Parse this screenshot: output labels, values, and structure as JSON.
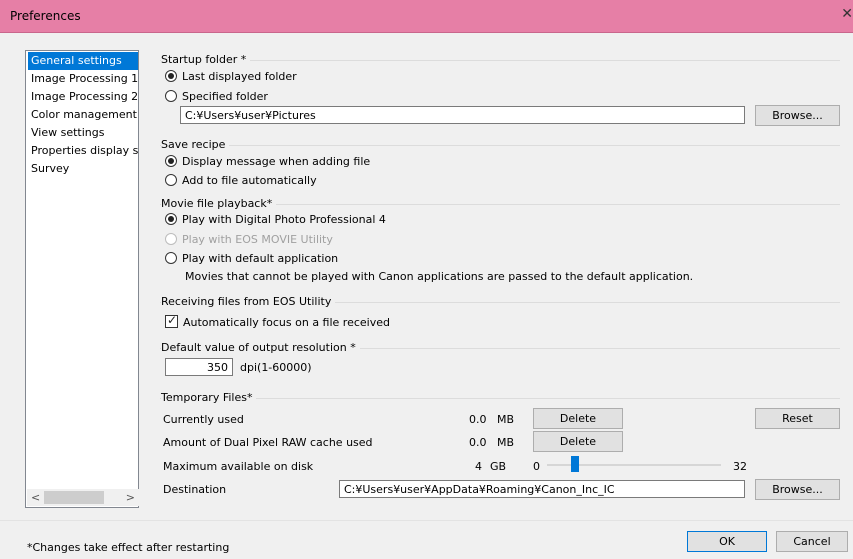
{
  "window": {
    "title": "Preferences",
    "close_glyph": "✕"
  },
  "sidebar": {
    "items": [
      {
        "label": "General settings",
        "selected": true
      },
      {
        "label": "Image Processing 1",
        "selected": false
      },
      {
        "label": "Image Processing 2",
        "selected": false
      },
      {
        "label": "Color management",
        "selected": false
      },
      {
        "label": "View settings",
        "selected": false
      },
      {
        "label": "Properties display sett",
        "selected": false
      },
      {
        "label": "Survey",
        "selected": false
      }
    ],
    "scroll_left": "<",
    "scroll_right": ">"
  },
  "startup_folder": {
    "label": "Startup folder *",
    "option_last": "Last displayed folder",
    "option_specified": "Specified folder",
    "selected": "last",
    "path": "C:¥Users¥user¥Pictures",
    "browse": "Browse..."
  },
  "save_recipe": {
    "label": "Save recipe",
    "option_display": "Display message when adding file",
    "option_add": "Add to file automatically",
    "selected": "display"
  },
  "movie_playback": {
    "label": "Movie file playback*",
    "option_dpp": "Play with Digital Photo Professional 4",
    "option_eos": "Play with EOS MOVIE Utility",
    "option_default": "Play with default application",
    "note": "Movies that cannot be played with Canon applications are passed to the default application.",
    "selected": "dpp"
  },
  "receiving_files": {
    "label": "Receiving files from EOS Utility",
    "auto_focus": "Automatically focus on a file received",
    "checked": true
  },
  "output_resolution": {
    "label": "Default value of output resolution *",
    "value": "350",
    "unit": "dpi(1-60000)"
  },
  "temporary_files": {
    "label": "Temporary Files*",
    "currently_used_label": "Currently used",
    "currently_used_value": "0.0",
    "currently_used_unit": "MB",
    "delete1": "Delete",
    "reset": "Reset",
    "dual_pixel_label": "Amount of Dual Pixel RAW cache used",
    "dual_pixel_value": "0.0",
    "dual_pixel_unit": "MB",
    "delete2": "Delete",
    "max_disk_label": "Maximum available on disk",
    "max_disk_value": "4",
    "max_disk_unit": "GB",
    "slider_min": "0",
    "slider_max": "32",
    "slider_value": 4,
    "destination_label": "Destination",
    "destination_path": "C:¥Users¥user¥AppData¥Roaming¥Canon_Inc_IC",
    "browse": "Browse..."
  },
  "footer": {
    "note": "*Changes take effect after restarting",
    "ok": "OK",
    "cancel": "Cancel"
  },
  "colors": {
    "titlebar": "#e67fa6",
    "selection": "#0078d7"
  }
}
